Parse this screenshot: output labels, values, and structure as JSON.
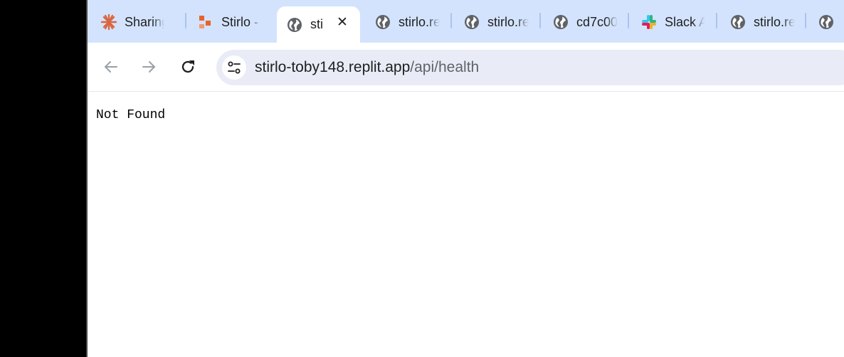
{
  "tabs": [
    {
      "title": "Sharing",
      "icon": "asterisk-icon",
      "active": false
    },
    {
      "title": "Stirlo -",
      "icon": "stirlo-logo-icon",
      "active": false
    },
    {
      "title": "sti",
      "icon": "globe-icon",
      "active": true
    },
    {
      "title": "stirlo.re",
      "icon": "globe-icon",
      "active": false
    },
    {
      "title": "stirlo.re",
      "icon": "globe-icon",
      "active": false
    },
    {
      "title": "cd7c00",
      "icon": "globe-icon",
      "active": false
    },
    {
      "title": "Slack A",
      "icon": "slack-icon",
      "active": false
    },
    {
      "title": "stirlo.re",
      "icon": "globe-icon",
      "active": false
    },
    {
      "title": "",
      "icon": "globe-icon",
      "active": false
    }
  ],
  "address_bar": {
    "host": "stirlo-toby148.replit.app",
    "path": "/api/health"
  },
  "page": {
    "body_text": "Not Found"
  },
  "colors": {
    "tabstrip": "#d3e3fd",
    "omnibox": "#e9ecf6",
    "accent_orange": "#e8622c"
  }
}
